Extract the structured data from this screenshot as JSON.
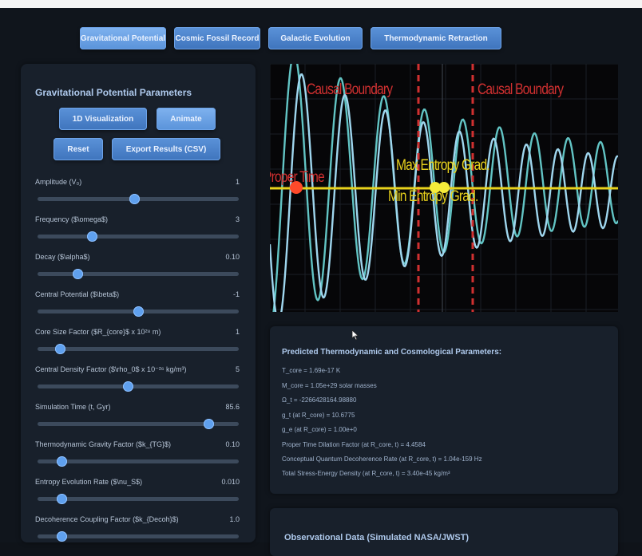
{
  "tabs": [
    {
      "label": "Gravitational Potential",
      "active": true
    },
    {
      "label": "Cosmic Fossil Record",
      "active": false
    },
    {
      "label": "Galactic Evolution",
      "active": false
    },
    {
      "label": "Thermodynamic Retraction",
      "active": false
    }
  ],
  "params_panel": {
    "title": "Gravitational Potential Parameters",
    "buttons": {
      "visualization": "1D Visualization",
      "animate": "Animate",
      "reset": "Reset",
      "export": "Export Results (CSV)"
    },
    "params": [
      {
        "label": "Amplitude (V₀)",
        "value": "1",
        "slider_fraction": 0.48
      },
      {
        "label": "Frequency ($\\omega$)",
        "value": "3",
        "slider_fraction": 0.27
      },
      {
        "label": "Decay ($\\alpha$)",
        "value": "0.10",
        "slider_fraction": 0.2
      },
      {
        "label": "Central Potential ($\\beta$)",
        "value": "-1",
        "slider_fraction": 0.5
      },
      {
        "label": "Core Size Factor ($R_{core}$ x 10²⁸ m)",
        "value": "1",
        "slider_fraction": 0.11
      },
      {
        "label": "Central Density Factor ($\\rho_0$ x 10⁻²⁶ kg/m³)",
        "value": "5",
        "slider_fraction": 0.45
      },
      {
        "label": "Simulation Time (t, Gyr)",
        "value": "85.6",
        "slider_fraction": 0.85
      },
      {
        "label": "Thermodynamic Gravity Factor ($k_{TG}$)",
        "value": "0.10",
        "slider_fraction": 0.12
      },
      {
        "label": "Entropy Evolution Rate ($\\nu_S$)",
        "value": "0.010",
        "slider_fraction": 0.12
      },
      {
        "label": "Decoherence Coupling Factor ($k_{Decoh}$)",
        "value": "1.0",
        "slider_fraction": 0.12
      }
    ]
  },
  "plot": {
    "labels": {
      "causal_boundary_left": "Causal Boundary",
      "causal_boundary_right": "Causal Boundary",
      "proper_time": "Proper Time",
      "max_entropy": "Max Entropy Grad.",
      "min_entropy": "Min Entropy Grad."
    },
    "colors": {
      "wave": "#9fd6ee",
      "wave_teal": "#62c4c4",
      "boundary": "#d03030",
      "axis_line": "#e8d21c",
      "marker_red": "#ff4a2a",
      "marker_yellow": "#f5ec3a"
    }
  },
  "results_panel": {
    "title": "Predicted Thermodynamic and Cosmological Parameters:",
    "lines": [
      "T_core = 1.69e-17 K",
      "M_core = 1.05e+29 solar masses",
      "Ω_t = -2266428164.98880",
      "g_t (at R_core) = 10.6775",
      "g_e (at R_core) = 1.00e+0",
      "Proper Time Dilation Factor (at R_core, t) = 4.4584",
      "Conceptual Quantum Decoherence Rate (at R_core, t) = 1.04e-159 Hz",
      "Total Stress-Energy Density (at R_core, t) = 3.40e-45 kg/m³"
    ]
  },
  "observational_panel": {
    "title": "Observational Data (Simulated NASA/JWST)"
  }
}
